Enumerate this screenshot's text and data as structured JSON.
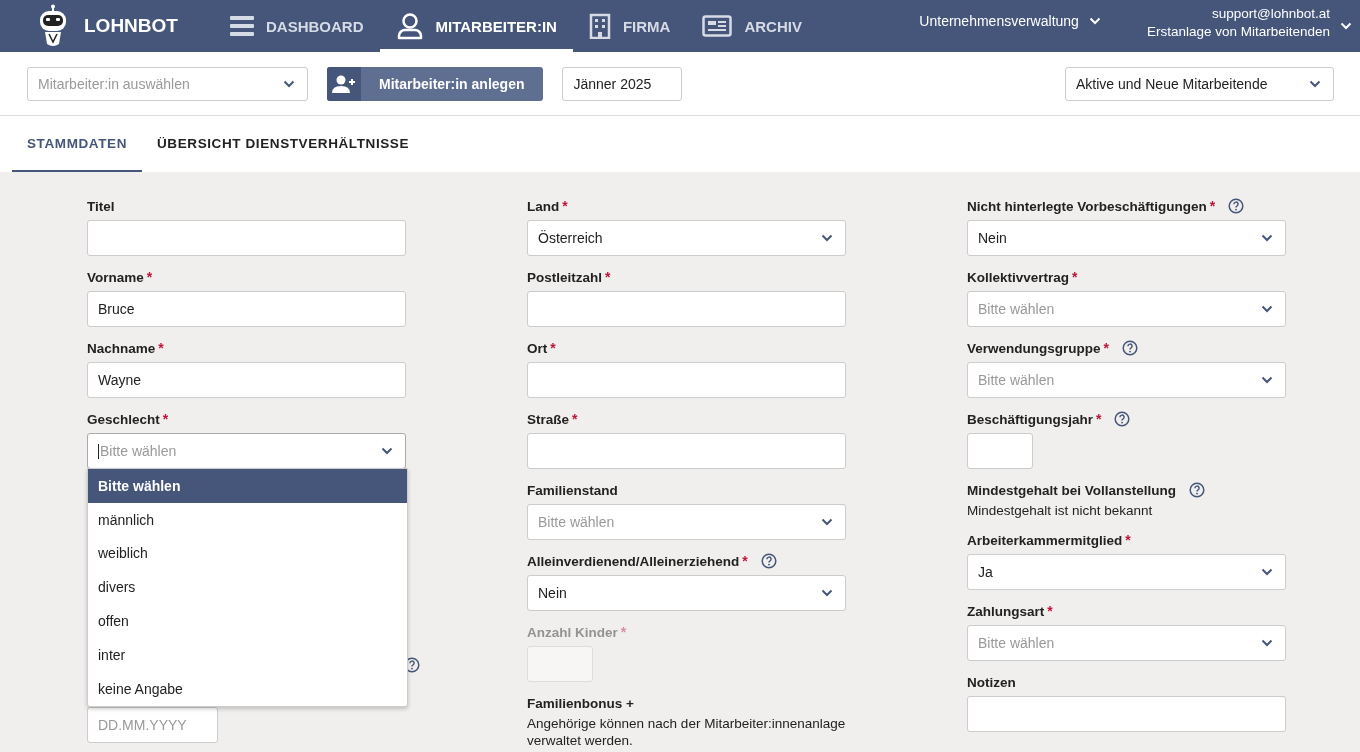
{
  "app": {
    "name": "LOHNBOT"
  },
  "nav": [
    {
      "label": "DASHBOARD",
      "selected": false
    },
    {
      "label": "MITARBEITER:IN",
      "selected": true
    },
    {
      "label": "FIRMA",
      "selected": false
    },
    {
      "label": "ARCHIV",
      "selected": false
    }
  ],
  "company_menu": {
    "label": "Unternehmensverwaltung"
  },
  "account": {
    "email": "support@lohnbot.at",
    "mode": "Erstanlage von Mitarbeitenden"
  },
  "toolbar": {
    "employee_select": {
      "placeholder": "Mitarbeiter:in auswählen"
    },
    "create_button": "Mitarbeiter:in anlegen",
    "period": "Jänner 2025",
    "filter": "Aktive und Neue Mitarbeitende"
  },
  "tabs": [
    {
      "label": "STAMMDATEN",
      "selected": true
    },
    {
      "label": "ÜBERSICHT DIENSTVERHÄLTNISSE",
      "selected": false
    }
  ],
  "columns": [
    [
      {
        "kind": "text",
        "label": "Titel"
      },
      {
        "kind": "text",
        "label": "Vorname",
        "required_mark": "*",
        "value": "Bruce"
      },
      {
        "kind": "text",
        "label": "Nachname",
        "required_mark": "*",
        "value": "Wayne"
      },
      {
        "kind": "select",
        "label": "Geschlecht",
        "required_mark": "*",
        "placeholder": "Bitte wählen",
        "open": true,
        "options": [
          {
            "label": "Bitte wählen",
            "selected": true
          },
          {
            "label": "männlich",
            "selected": false
          },
          {
            "label": "weiblich",
            "selected": false
          },
          {
            "label": "divers",
            "selected": false
          },
          {
            "label": "offen",
            "selected": false
          },
          {
            "label": "inter",
            "selected": false
          },
          {
            "label": "keine Angabe",
            "selected": false
          }
        ]
      },
      {
        "kind": "covered",
        "help": true
      },
      {
        "kind": "date",
        "placeholder": "DD.MM.YYYY"
      }
    ],
    [
      {
        "kind": "select",
        "label": "Land",
        "required_mark": "*",
        "value": "Österreich"
      },
      {
        "kind": "text",
        "label": "Postleitzahl",
        "required_mark": "*"
      },
      {
        "kind": "text",
        "label": "Ort",
        "required_mark": "*"
      },
      {
        "kind": "text",
        "label": "Straße",
        "required_mark": "*"
      },
      {
        "kind": "select",
        "label": "Familienstand",
        "placeholder": "Bitte wählen"
      },
      {
        "kind": "select",
        "label": "Alleinverdienend/Alleinerziehend",
        "required_mark": "*",
        "help": true,
        "value": "Nein"
      },
      {
        "kind": "small",
        "label": "Anzahl Kinder",
        "required_mark": "*",
        "disabled": true
      },
      {
        "kind": "info",
        "label": "Familienbonus +",
        "text": "Angehörige können nach der Mitarbeiter:innenanlage verwaltet werden."
      }
    ],
    [
      {
        "kind": "select",
        "label": "Nicht hinterlegte Vorbeschäftigungen",
        "required_mark": "*",
        "help": true,
        "value": "Nein"
      },
      {
        "kind": "select",
        "label": "Kollektivvertrag",
        "required_mark": "*",
        "placeholder": "Bitte wählen"
      },
      {
        "kind": "select",
        "label": "Verwendungsgruppe",
        "required_mark": "*",
        "help": true,
        "placeholder": "Bitte wählen"
      },
      {
        "kind": "small",
        "label": "Beschäftigungsjahr",
        "required_mark": "*",
        "help": true,
        "disabled": false
      },
      {
        "kind": "info",
        "label": "Mindestgehalt bei Vollanstellung",
        "help": true,
        "text": "Mindestgehalt ist nicht bekannt"
      },
      {
        "kind": "select",
        "label": "Arbeiterkammermitglied",
        "required_mark": "*",
        "value": "Ja"
      },
      {
        "kind": "select",
        "label": "Zahlungsart",
        "required_mark": "*",
        "placeholder": "Bitte wählen"
      },
      {
        "kind": "text",
        "label": "Notizen"
      }
    ]
  ]
}
